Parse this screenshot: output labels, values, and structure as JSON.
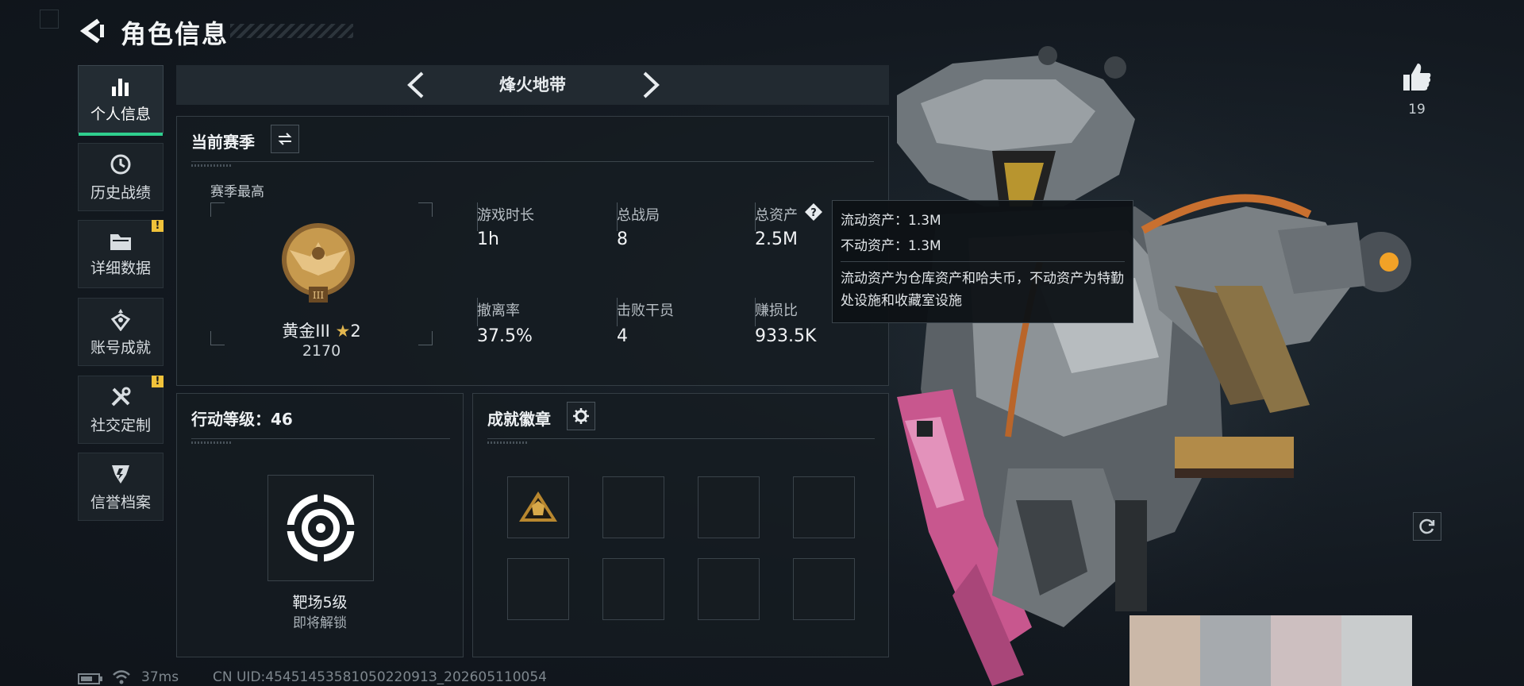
{
  "header": {
    "title": "角色信息"
  },
  "sidebar": {
    "items": [
      {
        "label": "个人信息",
        "icon": "bar-chart-icon",
        "active": true,
        "alert": false
      },
      {
        "label": "历史战绩",
        "icon": "history-clock-icon",
        "active": false,
        "alert": false
      },
      {
        "label": "详细数据",
        "icon": "folder-icon",
        "active": false,
        "alert": true
      },
      {
        "label": "账号成就",
        "icon": "achievement-emblem-icon",
        "active": false,
        "alert": false
      },
      {
        "label": "社交定制",
        "icon": "tools-icon",
        "active": false,
        "alert": true
      },
      {
        "label": "信誉档案",
        "icon": "credit-shield-icon",
        "active": false,
        "alert": false
      }
    ],
    "alert_mark": "!"
  },
  "mode": {
    "label": "烽火地带"
  },
  "season": {
    "title": "当前赛季",
    "best_label": "赛季最高",
    "rank_name": "黄金III",
    "rank_stars": "2",
    "rank_points": "2170",
    "rank_roman": "III",
    "stats": [
      {
        "label": "游戏时长",
        "value": "1h"
      },
      {
        "label": "总战局",
        "value": "8"
      },
      {
        "label": "总资产",
        "value": "2.5M"
      },
      {
        "label": "撤离率",
        "value": "37.5%"
      },
      {
        "label": "击败干员",
        "value": "4"
      },
      {
        "label": "赚损比",
        "value": "933.5K"
      }
    ]
  },
  "tooltip": {
    "line1": "流动资产：1.3M",
    "line2": "不动资产：1.3M",
    "desc": "流动资产为仓库资产和哈夫币，不动资产为特勤处设施和收藏室设施"
  },
  "action_level": {
    "title": "行动等级：46",
    "item_title": "靶场5级",
    "item_status": "即将解锁"
  },
  "achievements": {
    "title": "成就徽章"
  },
  "likes": {
    "count": "19"
  },
  "footer": {
    "ping": "37ms",
    "uid": "CN UID:4545145358105022091З_202605110054"
  },
  "colors": {
    "accent": "#2fcf8e",
    "alert": "#f0c23a",
    "gold": "#c79a4e",
    "swatches": [
      "#cbb8a8",
      "#a6aaae",
      "#cdbfc0",
      "#c9cccd"
    ]
  }
}
